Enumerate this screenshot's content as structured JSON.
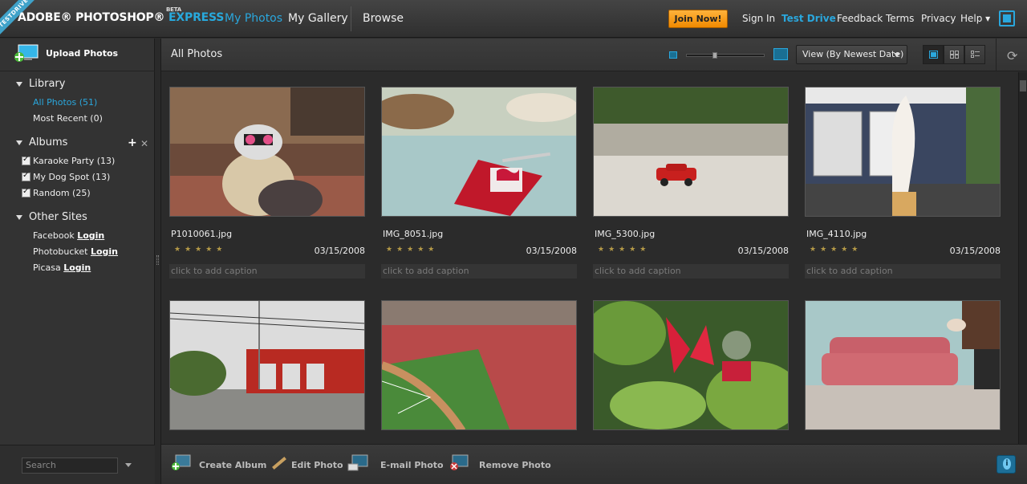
{
  "header": {
    "ribbon": "TESTDRIVE",
    "logo_main": "ADOBE® PHOTOSHOP®",
    "logo_express": "EXPRESS",
    "logo_beta": "BETA",
    "nav": [
      "My Photos",
      "My Gallery",
      "Browse"
    ],
    "join_label": "Join Now!",
    "links": [
      "Sign In",
      "Test Drive",
      "Feedback",
      "Terms",
      "Privacy",
      "Help ▾"
    ]
  },
  "sidebar": {
    "upload_label": "Upload Photos",
    "library_title": "Library",
    "library_items": [
      "All Photos (51)",
      "Most Recent (0)"
    ],
    "albums_title": "Albums",
    "albums": [
      "Karaoke Party (13)",
      "My Dog Spot (13)",
      "Random (25)"
    ],
    "other_title": "Other Sites",
    "other_sites": [
      {
        "name": "Facebook",
        "action": "Login"
      },
      {
        "name": "Photobucket",
        "action": "Login"
      },
      {
        "name": "Picasa",
        "action": "Login"
      }
    ],
    "search_placeholder": "Search"
  },
  "main": {
    "title": "All Photos",
    "view_select": "View (By Newest Date)",
    "zoom_level": 0.35,
    "photos": [
      {
        "file": "P1010061.jpg",
        "date": "03/15/2008",
        "stars": "★★★★★",
        "caption": "click to add caption"
      },
      {
        "file": "IMG_8051.jpg",
        "date": "03/15/2008",
        "stars": "★★★★★",
        "caption": "click to add caption"
      },
      {
        "file": "IMG_5300.jpg",
        "date": "03/15/2008",
        "stars": "★★★★★",
        "caption": "click to add caption"
      },
      {
        "file": "IMG_4110.jpg",
        "date": "03/15/2008",
        "stars": "★★★★★",
        "caption": "click to add caption"
      }
    ]
  },
  "toolbar": {
    "create_album": "Create Album",
    "edit_photo": "Edit Photo",
    "email_photo": "E-mail Photo",
    "remove_photo": "Remove Photo"
  }
}
